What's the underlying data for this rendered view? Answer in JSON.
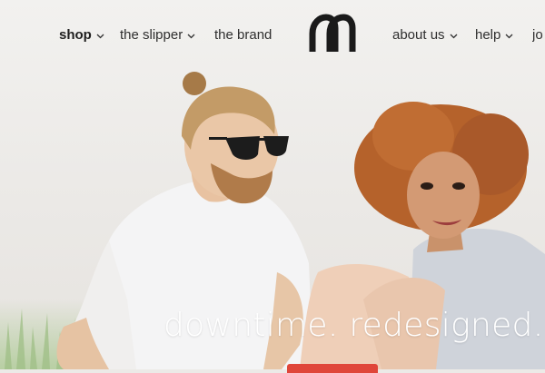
{
  "nav": {
    "items": [
      {
        "label": "shop",
        "dropdown": true,
        "active": true
      },
      {
        "label": "the slipper",
        "dropdown": true,
        "active": false
      },
      {
        "label": "the brand",
        "dropdown": false,
        "active": false
      },
      {
        "label": "about us",
        "dropdown": true,
        "active": false
      },
      {
        "label": "help",
        "dropdown": true,
        "active": false
      },
      {
        "label": "jo",
        "dropdown": false,
        "active": false
      }
    ],
    "logo_icon": "mahabis-logo-icon"
  },
  "hero": {
    "tagline": "downtime. redesigned.",
    "cta_color": "#e0463a"
  },
  "colors": {
    "accent": "#e0463a",
    "nav_text": "#2f2f2f",
    "background": "#eceae7"
  }
}
